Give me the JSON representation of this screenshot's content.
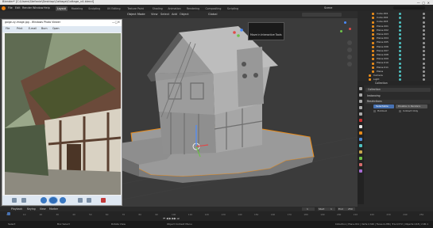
{
  "window_title": "Blender* [C:\\Users\\Stefanie\\Desktop\\Cottage\\Cottage_v4.blend]",
  "menubar": {
    "items": [
      "File",
      "Edit",
      "Render",
      "Window",
      "Help"
    ],
    "workspaces": [
      "Layout",
      "Modeling",
      "Sculpting",
      "UV Editing",
      "Texture Paint",
      "Shading",
      "Animation",
      "Rendering",
      "Compositing",
      "Scripting"
    ],
    "active_workspace": "Layout",
    "scene_label": "Scene",
    "view_layer_label": "View Layer"
  },
  "viewport": {
    "mode_label": "Object Mode",
    "menu": [
      "View",
      "Select",
      "Add",
      "Object"
    ],
    "orientation": "Global",
    "tooltip": "Move in Interactive Tools"
  },
  "photo_viewer": {
    "title": "gaige-vy-image.jpg - Windows Photo Viewer",
    "toolbar": [
      "File",
      "Print",
      "E-mail",
      "Burn",
      "Open"
    ]
  },
  "outliner": {
    "items": [
      {
        "label": "Cube.001",
        "indent": 1
      },
      {
        "label": "Cube.002",
        "indent": 1
      },
      {
        "label": "Cube.003",
        "indent": 1
      },
      {
        "label": "Plane.001",
        "indent": 1
      },
      {
        "label": "Plane.002",
        "indent": 1
      },
      {
        "label": "Plane.003",
        "indent": 1
      },
      {
        "label": "Plane.004",
        "indent": 1
      },
      {
        "label": "Plane.005",
        "indent": 1
      },
      {
        "label": "Plane.006",
        "indent": 1
      },
      {
        "label": "Plane.007",
        "indent": 1
      },
      {
        "label": "Plane.008",
        "indent": 1
      },
      {
        "label": "Plane.009",
        "indent": 1
      },
      {
        "label": "Plane.010",
        "indent": 1
      },
      {
        "label": "Plane.011",
        "indent": 1
      },
      {
        "label": "Plane",
        "indent": 1
      },
      {
        "label": "Camera",
        "indent": 0
      },
      {
        "label": "Light",
        "indent": 0
      }
    ]
  },
  "properties": {
    "header": "Collection",
    "object_name": "Collection",
    "section1": "Instancing",
    "row_labels": [
      "Restrictions",
      "Selectable",
      "Disable in Renders",
      "Holdout",
      "Indirect Only"
    ],
    "tabs": [
      "Tool",
      "Render",
      "Output",
      "View Layer",
      "Scene",
      "World",
      "Collection",
      "Object",
      "Modifiers",
      "Physics",
      "Constraints",
      "Data",
      "Material",
      "Texture"
    ]
  },
  "timeline": {
    "menu": [
      "Playback",
      "Keying",
      "View",
      "Marker"
    ],
    "frame_current": "1",
    "start_label": "Start",
    "start": "1",
    "end_label": "End",
    "end": "250",
    "ticks": [
      "0",
      "10",
      "20",
      "30",
      "40",
      "50",
      "60",
      "70",
      "80",
      "90",
      "100",
      "110",
      "120",
      "130",
      "140",
      "150",
      "160",
      "170",
      "180",
      "190",
      "200",
      "210",
      "220",
      "230",
      "240",
      "250"
    ]
  },
  "statusbar": {
    "left": "Select",
    "mid1": "Box Select",
    "mid2": "Rotate View",
    "mid3": "Object Context Menu",
    "right": "Collection | Plane.011 | Verts:2,340 | Faces:2,286 | Tris:4,572 | Objects:1/18 | 2.90.1"
  },
  "colors": {
    "accent": "#4772b3",
    "selected": "#ff8c1a",
    "viewport_bg": "#3b3b3b"
  }
}
